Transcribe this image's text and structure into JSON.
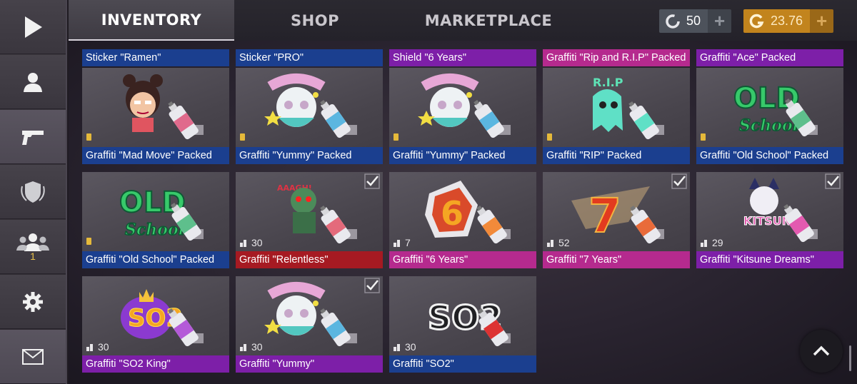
{
  "sidebar": {
    "items": [
      {
        "icon": "play-icon"
      },
      {
        "icon": "profile-icon"
      },
      {
        "icon": "pistol-icon"
      },
      {
        "icon": "clan-shield-icon"
      },
      {
        "icon": "friends-icon",
        "badge": "1"
      },
      {
        "icon": "gear-icon"
      },
      {
        "icon": "mail-icon"
      }
    ]
  },
  "tabs": [
    {
      "label": "INVENTORY"
    },
    {
      "label": "SHOP"
    },
    {
      "label": "MARKETPLACE"
    }
  ],
  "currency": {
    "silver": {
      "value": "50",
      "color": "#4a4f58"
    },
    "gold": {
      "value": "23.76",
      "color": "#c98a1f"
    }
  },
  "top_strip": [
    {
      "label": "Sticker \"Ramen\"",
      "color": "blue"
    },
    {
      "label": "Sticker \"PRO\"",
      "color": "blue"
    },
    {
      "label": "Shield \"6 Years\"",
      "color": "purple"
    },
    {
      "label": "Graffiti \"Rip and R.I.P\" Packed",
      "color": "magenta"
    },
    {
      "label": "Graffiti \"Ace\" Packed",
      "color": "purple"
    }
  ],
  "items": [
    {
      "label": "Graffiti \"Mad Move\" Packed",
      "color": "blue",
      "count": "",
      "checked": false,
      "art": "madmove"
    },
    {
      "label": "Graffiti \"Yummy\" Packed",
      "color": "blue",
      "count": "",
      "checked": false,
      "art": "yummy"
    },
    {
      "label": "Graffiti \"Yummy\" Packed",
      "color": "blue",
      "count": "",
      "checked": false,
      "art": "yummy"
    },
    {
      "label": "Graffiti \"RIP\" Packed",
      "color": "blue",
      "count": "",
      "checked": false,
      "art": "rip"
    },
    {
      "label": "Graffiti \"Old School\" Packed",
      "color": "blue",
      "count": "",
      "checked": false,
      "art": "oldschool"
    },
    {
      "label": "Graffiti \"Old School\" Packed",
      "color": "blue",
      "count": "",
      "checked": false,
      "art": "oldschool"
    },
    {
      "label": "Graffiti \"Relentless\"",
      "color": "red",
      "count": "30",
      "checked": true,
      "art": "relentless"
    },
    {
      "label": "Graffiti \"6 Years\"",
      "color": "magenta",
      "count": "7",
      "checked": false,
      "art": "sixyears"
    },
    {
      "label": "Graffiti \"7 Years\"",
      "color": "magenta",
      "count": "52",
      "checked": true,
      "art": "sevenyears"
    },
    {
      "label": "Graffiti \"Kitsune Dreams\"",
      "color": "purple",
      "count": "29",
      "checked": true,
      "art": "kitsune"
    },
    {
      "label": "Graffiti \"SO2 King\"",
      "color": "purple",
      "count": "30",
      "checked": false,
      "art": "so2king"
    },
    {
      "label": "Graffiti \"Yummy\"",
      "color": "purple",
      "count": "30",
      "checked": true,
      "art": "yummy"
    },
    {
      "label": "Graffiti \"SO2\"",
      "color": "blue",
      "count": "30",
      "checked": false,
      "art": "so2"
    }
  ]
}
